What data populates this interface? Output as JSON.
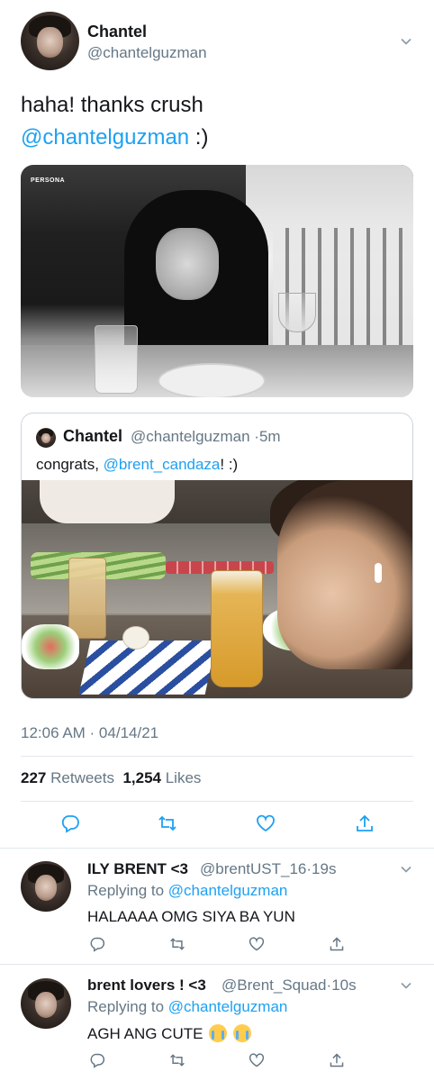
{
  "main_tweet": {
    "name": "Chantel",
    "handle": "@chantelguzman",
    "text": "haha! thanks crush",
    "mention": "@chantelguzman",
    "text_suffix": " :)",
    "photo_tag": "PERSONA",
    "quoted": {
      "name": "Chantel",
      "handle": "@chantelguzman",
      "time": "5m",
      "text_prefix": "congrats, ",
      "mention": "@brent_candaza",
      "text_suffix": "! :)"
    },
    "timestamp": "12:06 AM · 04/14/21",
    "retweets_count": "227",
    "retweets_label": "Retweets",
    "likes_count": "1,254",
    "likes_label": "Likes"
  },
  "replies": [
    {
      "name": "ILY BRENT <3",
      "handle": "@brentUST_16",
      "time": "19s",
      "replying_prefix": "Replying to",
      "replying_to": "@chantelguzman",
      "text": "HALAAAA OMG SIYA BA YUN"
    },
    {
      "name": "brent lovers ! <3",
      "handle": "@Brent_Squad",
      "time": "10s",
      "replying_prefix": "Replying to",
      "replying_to": "@chantelguzman",
      "text": "AGH ANG CUTE",
      "emojis": [
        "crying-face",
        "crying-face"
      ]
    }
  ],
  "icons": [
    "caret-down-icon",
    "reply-icon",
    "retweet-icon",
    "like-icon",
    "share-icon"
  ],
  "colors": {
    "link": "#1da1f2",
    "secondary_text": "#657786",
    "divider": "#e1e8ed",
    "primary_text": "#14171a"
  }
}
